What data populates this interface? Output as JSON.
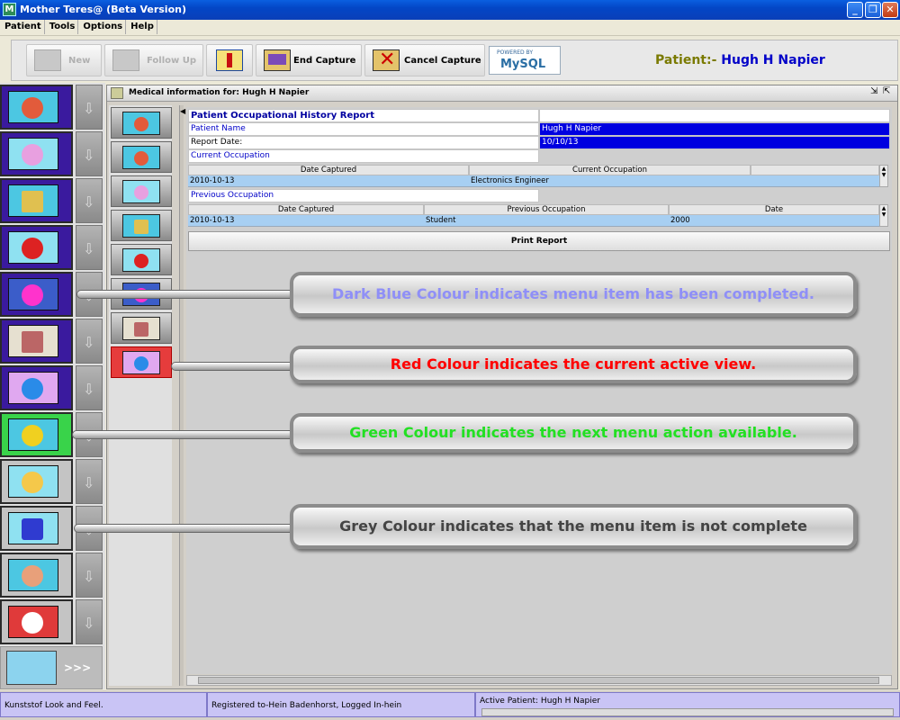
{
  "window": {
    "title": "Mother Teres@ (Beta Version)",
    "app_icon": "M"
  },
  "menu": [
    "Patient",
    "Tools",
    "Options",
    "Help"
  ],
  "toolbar": {
    "new_label": "New",
    "follow_up_label": "Follow Up",
    "end_capture_label": "End Capture",
    "cancel_capture_label": "Cancel Capture",
    "mysql_powered": "POWERED BY",
    "mysql_brand": "MySQL"
  },
  "patient_header": {
    "label": "Patient:-",
    "name": "Hugh H Napier"
  },
  "frame": {
    "title": "Medical information for: Hugh H Napier"
  },
  "report": {
    "title": "Patient Occupational History Report",
    "patient_name_label": "Patient Name",
    "patient_name": "Hugh H Napier",
    "report_date_label": "Report Date:",
    "report_date": "10/10/13",
    "current_section": "Current Occupation",
    "current_columns": [
      "Date Captured",
      "Current Occupation"
    ],
    "current_rows": [
      {
        "date": "2010-10-13",
        "occupation": "Electronics Engineer"
      }
    ],
    "previous_section": "Previous Occupation",
    "previous_columns": [
      "Date Captured",
      "Previous Occupation",
      "Date"
    ],
    "previous_rows": [
      {
        "date": "2010-10-13",
        "occupation": "Student",
        "year": "2000"
      }
    ],
    "print_label": "Print Report"
  },
  "callouts": {
    "dark_blue": "Dark Blue Colour indicates menu item has been completed.",
    "red": "Red Colour indicates the current active view.",
    "green": "Green Colour indicates  the next menu action available.",
    "grey": "Grey Colour indicates that the menu item is not complete"
  },
  "sidebar_more": ">>>",
  "status": {
    "look": "Kunststof Look and Feel.",
    "registered": "Registered to-Hein Badenhorst, Logged In-hein",
    "active_patient": "Active Patient: Hugh H Napier"
  },
  "colors": {
    "completed": "#3a1a9e",
    "active": "#e63c3c",
    "next": "#39d34a",
    "not_complete": "#c4c4c4",
    "callout_blue": "#8f8ff7",
    "callout_red": "#ff0000",
    "callout_green": "#22e022",
    "callout_grey": "#444444"
  }
}
